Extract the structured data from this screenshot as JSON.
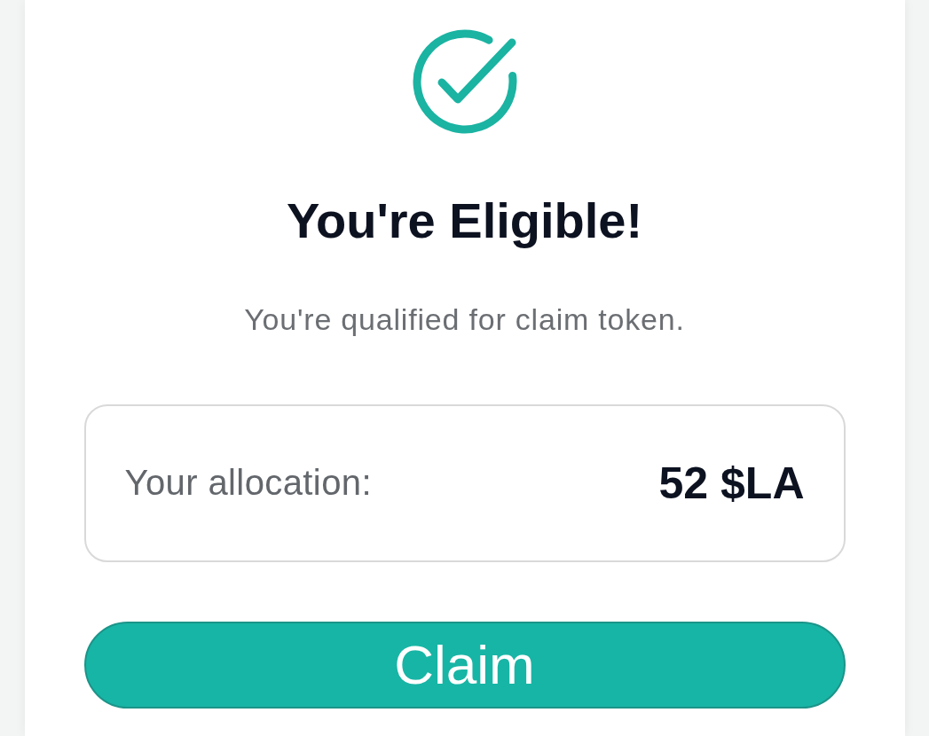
{
  "title": "You're Eligible!",
  "subtitle": "You're qualified for claim token.",
  "allocation": {
    "label": "Your allocation:",
    "value": "52 $LA"
  },
  "button": {
    "label": "Claim"
  }
}
